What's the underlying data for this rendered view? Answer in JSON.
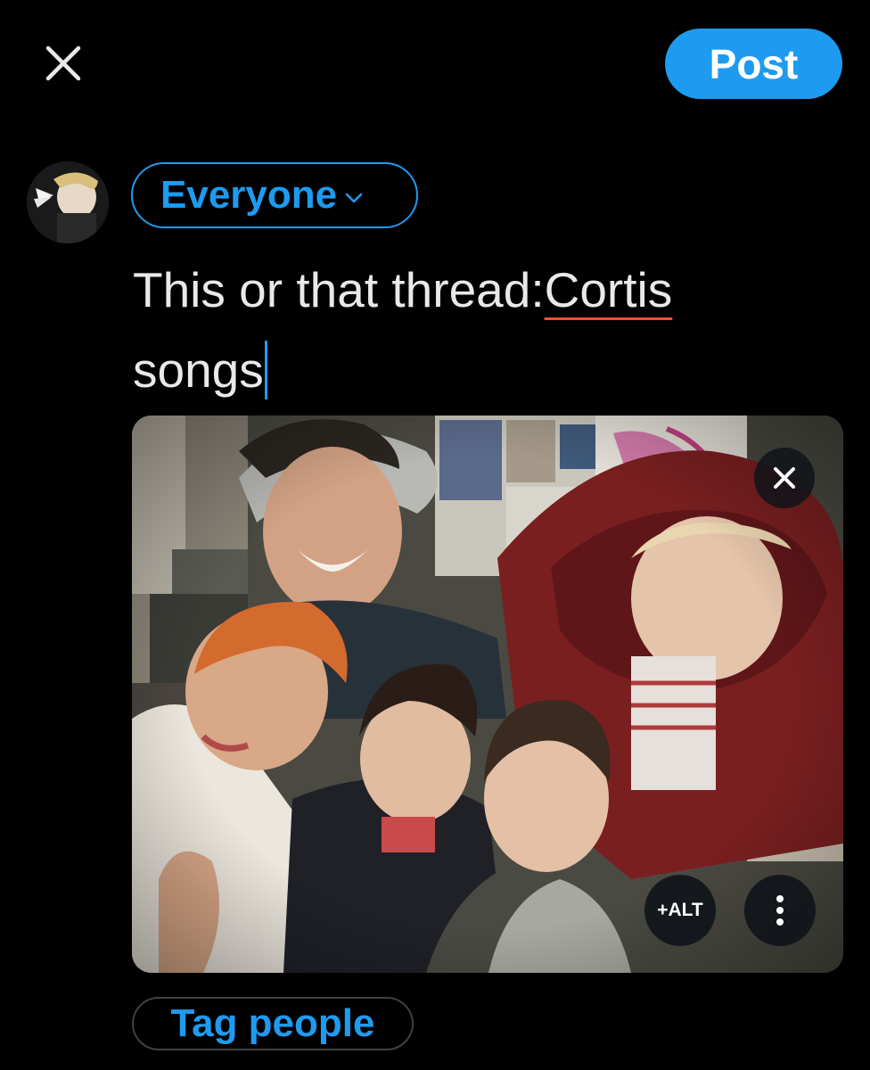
{
  "header": {
    "close_icon": "close-icon",
    "post_label": "Post"
  },
  "composer": {
    "audience_label": "Everyone",
    "text_part1": "This or that thread:",
    "text_misspelled": "Cortis",
    "text_part2": "songs"
  },
  "media": {
    "alt_label": "+ALT",
    "remove_icon": "close-icon",
    "more_icon": "more-vertical-icon"
  },
  "footer": {
    "tag_people_label": "Tag people"
  },
  "colors": {
    "accent": "#1d9bf0",
    "background": "#000000",
    "text": "#e7e9ea",
    "spellcheck": "#f4512b"
  }
}
